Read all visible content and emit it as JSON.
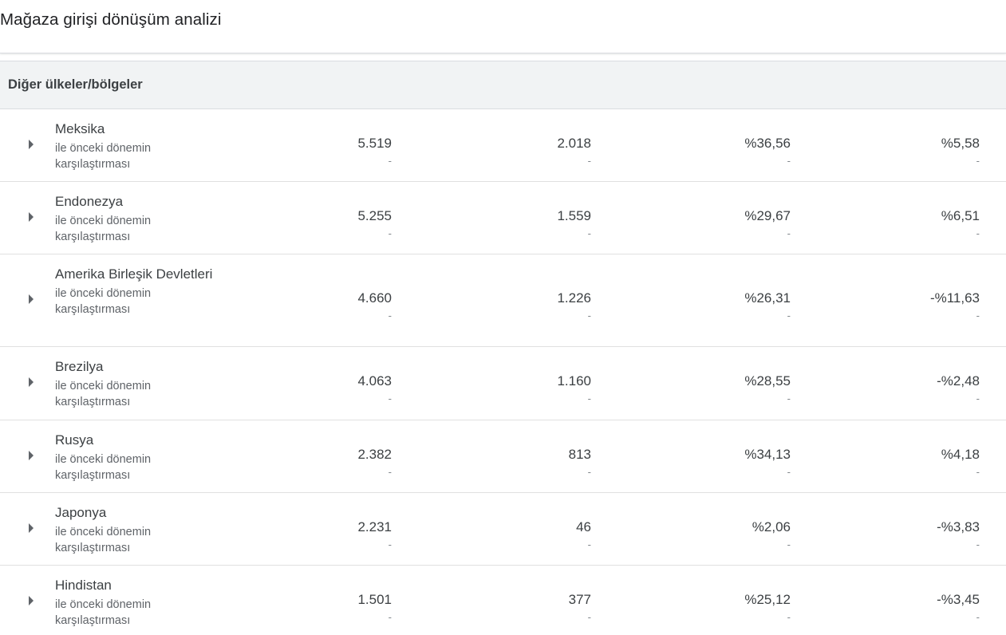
{
  "page": {
    "title": "Mağaza girişi dönüşüm analizi"
  },
  "group": {
    "label": "Diğer ülkeler/bölgeler"
  },
  "compare_label": "ile önceki dönemin karşılaştırması",
  "colors": {
    "header_bg": "#f1f3f4",
    "text_primary": "#3c4043",
    "text_secondary": "#5f6368",
    "divider": "#e0e0e0"
  },
  "icons": {
    "expand": "caret-right-icon"
  },
  "rows": [
    {
      "country": "Meksika",
      "values": [
        "5.519",
        "2.018",
        "%36,56",
        "%5,58"
      ],
      "changes": [
        "-",
        "-",
        "-",
        "-"
      ]
    },
    {
      "country": "Endonezya",
      "values": [
        "5.255",
        "1.559",
        "%29,67",
        "%6,51"
      ],
      "changes": [
        "-",
        "-",
        "-",
        "-"
      ]
    },
    {
      "country": "Amerika Birleşik Devletleri",
      "values": [
        "4.660",
        "1.226",
        "%26,31",
        "-%11,63"
      ],
      "changes": [
        "-",
        "-",
        "-",
        "-"
      ]
    },
    {
      "country": "Brezilya",
      "values": [
        "4.063",
        "1.160",
        "%28,55",
        "-%2,48"
      ],
      "changes": [
        "-",
        "-",
        "-",
        "-"
      ]
    },
    {
      "country": "Rusya",
      "values": [
        "2.382",
        "813",
        "%34,13",
        "%4,18"
      ],
      "changes": [
        "-",
        "-",
        "-",
        "-"
      ]
    },
    {
      "country": "Japonya",
      "values": [
        "2.231",
        "46",
        "%2,06",
        "-%3,83"
      ],
      "changes": [
        "-",
        "-",
        "-",
        "-"
      ]
    },
    {
      "country": "Hindistan",
      "values": [
        "1.501",
        "377",
        "%25,12",
        "-%3,45"
      ],
      "changes": [
        "-",
        "-",
        "-",
        "-"
      ]
    }
  ]
}
